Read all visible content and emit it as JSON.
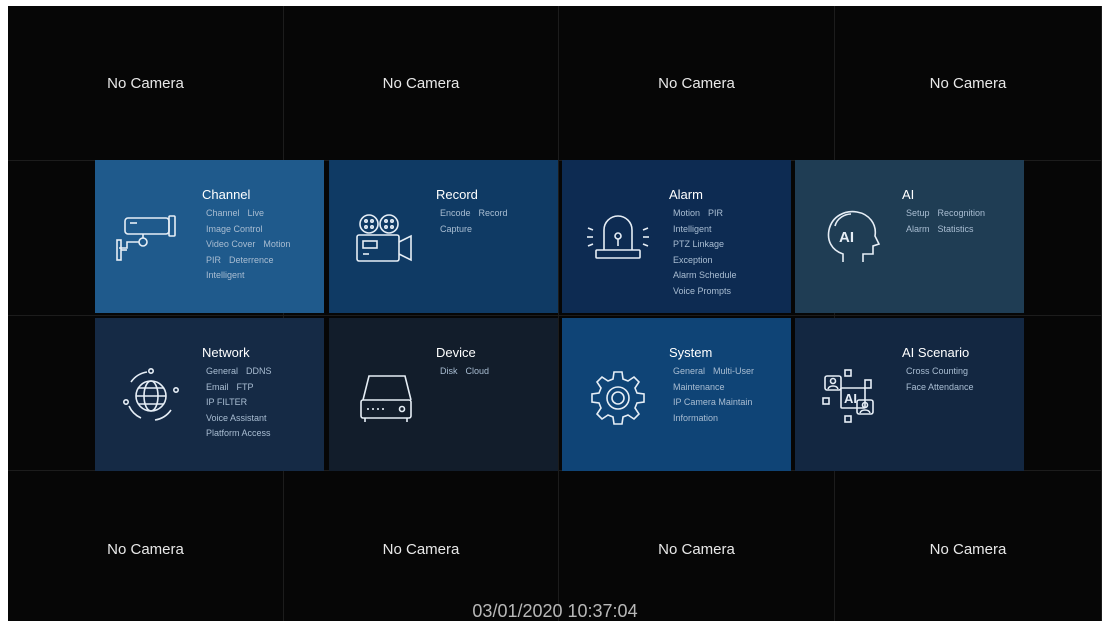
{
  "cameras": {
    "top": [
      "No Camera",
      "No Camera",
      "No Camera",
      "No Camera"
    ],
    "bottom": [
      "No Camera",
      "No Camera",
      "No Camera",
      "No Camera"
    ]
  },
  "menu": {
    "channel": {
      "title": "Channel",
      "icon": "camera-icon",
      "rows": [
        [
          "Channel",
          "Live"
        ],
        [
          "Image Control"
        ],
        [
          "Video Cover",
          "Motion"
        ],
        [
          "PIR",
          "Deterrence"
        ],
        [
          "Intelligent"
        ]
      ]
    },
    "record": {
      "title": "Record",
      "icon": "video-camera-icon",
      "rows": [
        [
          "Encode",
          "Record"
        ],
        [
          "Capture"
        ]
      ]
    },
    "alarm": {
      "title": "Alarm",
      "icon": "siren-icon",
      "rows": [
        [
          "Motion",
          "PIR"
        ],
        [
          "Intelligent"
        ],
        [
          "PTZ Linkage"
        ],
        [
          "Exception"
        ],
        [
          "Alarm Schedule"
        ],
        [
          "Voice Prompts"
        ]
      ]
    },
    "ai": {
      "title": "AI",
      "icon": "ai-head-icon",
      "rows": [
        [
          "Setup",
          "Recognition"
        ],
        [
          "Alarm",
          "Statistics"
        ]
      ]
    },
    "network": {
      "title": "Network",
      "icon": "globe-icon",
      "rows": [
        [
          "General",
          "DDNS"
        ],
        [
          "Email",
          "FTP"
        ],
        [
          "IP FILTER"
        ],
        [
          "Voice Assistant"
        ],
        [
          "Platform Access"
        ]
      ]
    },
    "device": {
      "title": "Device",
      "icon": "storage-device-icon",
      "rows": [
        [
          "Disk",
          "Cloud"
        ]
      ]
    },
    "system": {
      "title": "System",
      "icon": "gear-icon",
      "rows": [
        [
          "General",
          "Multi-User"
        ],
        [
          "Maintenance"
        ],
        [
          "IP Camera Maintain"
        ],
        [
          "Information"
        ]
      ]
    },
    "aiscenario": {
      "title": "AI Scenario",
      "icon": "ai-scenario-icon",
      "rows": [
        [
          "Cross Counting"
        ],
        [
          "Face Attendance"
        ]
      ]
    }
  },
  "status": {
    "datetime": "03/01/2020 10:37:04"
  }
}
